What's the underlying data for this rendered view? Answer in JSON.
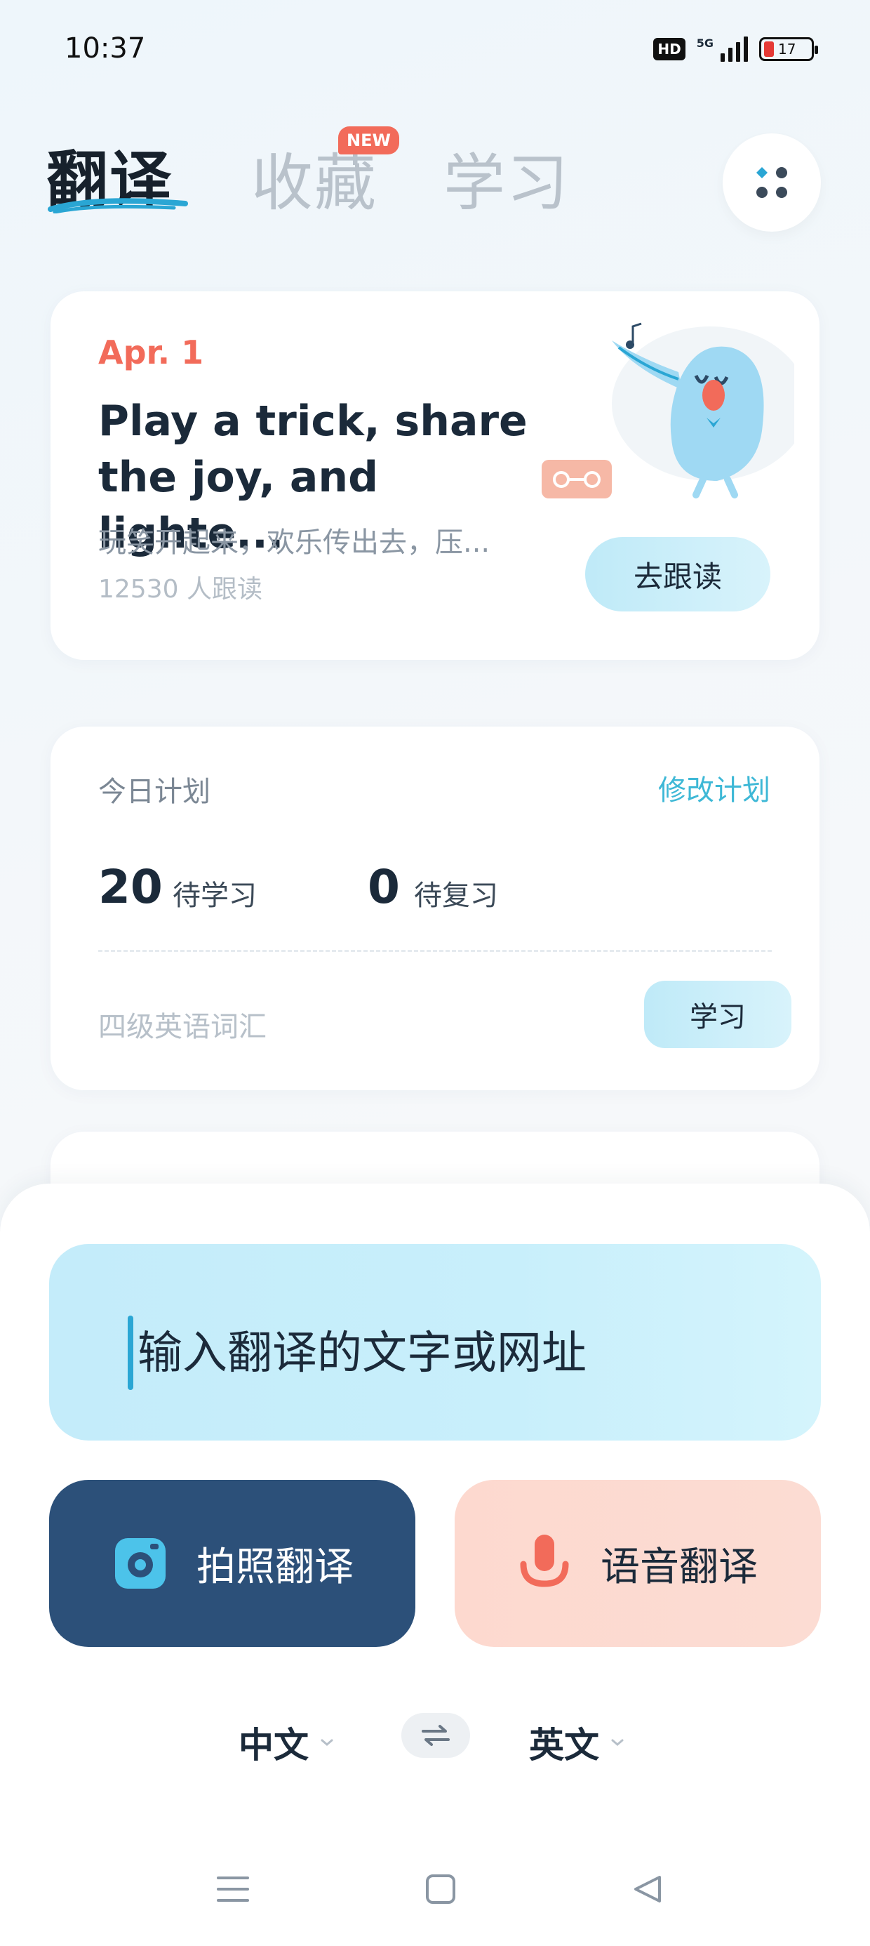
{
  "status_bar": {
    "time": "10:37",
    "hd": "HD",
    "network": "5G",
    "battery": "17"
  },
  "nav": {
    "tabs": [
      {
        "label": "翻译",
        "active": true
      },
      {
        "label": "收藏",
        "active": false
      },
      {
        "label": "学习",
        "active": false
      }
    ],
    "new_badge": "NEW",
    "menu_icon": "dots-grid-icon"
  },
  "daily": {
    "date": "Apr. 1",
    "sentence_en": "Play a trick, share the joy, and lighte...",
    "sentence_cn": "玩笑开起来，欢乐传出去，压...",
    "readers": "12530 人跟读",
    "follow_label": "去跟读",
    "illustration": "singing-bird-illustration"
  },
  "plan": {
    "title": "今日计划",
    "edit_label": "修改计划",
    "to_learn_count": "20",
    "to_learn_label": "待学习",
    "to_review_count": "0",
    "to_review_label": "待复习",
    "book": "四级英语词汇",
    "study_label": "学习"
  },
  "translate": {
    "input_placeholder": "输入翻译的文字或网址",
    "photo_label": "拍照翻译",
    "voice_label": "语音翻译",
    "source_lang": "中文",
    "target_lang": "英文"
  },
  "colors": {
    "accent_orange": "#f26b5a",
    "accent_cyan": "#3eb8d6",
    "photo_button_bg": "#2c5079",
    "voice_button_bg": "#fdd9cf",
    "input_bg": "#c4ecfa"
  }
}
